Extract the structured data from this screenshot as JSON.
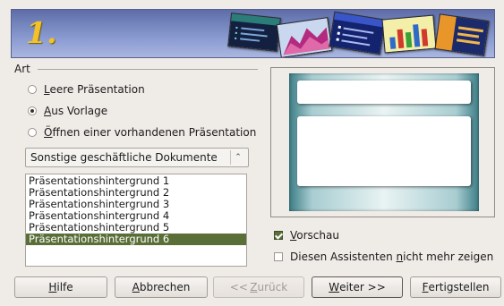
{
  "banner": {
    "step_number": "1."
  },
  "art": {
    "label": "Art",
    "radios": [
      {
        "pre": "",
        "accel": "L",
        "post": "eere Präsentation",
        "selected": false
      },
      {
        "pre": "",
        "accel": "A",
        "post": "us Vorlage",
        "selected": true
      },
      {
        "pre": "",
        "accel": "Ö",
        "post": "ffnen einer vorhandenen Präsentation",
        "selected": false
      }
    ]
  },
  "category_select": {
    "value": "Sonstige geschäftliche Dokumente"
  },
  "template_list": {
    "items": [
      "Präsentationshintergrund 1",
      "Präsentationshintergrund 2",
      "Präsentationshintergrund 3",
      "Präsentationshintergrund 4",
      "Präsentationshintergrund 5",
      "Präsentationshintergrund 6"
    ],
    "selected_index": 5
  },
  "preview_check": {
    "pre": "",
    "accel": "V",
    "post": "orschau",
    "checked": true
  },
  "no_wizard_check": {
    "pre": "Diesen Assistenten ",
    "accel": "n",
    "post": "icht mehr zeigen",
    "checked": false
  },
  "buttons": {
    "help": {
      "pre": "",
      "accel": "H",
      "post": "ilfe"
    },
    "cancel": {
      "pre": "",
      "accel": "A",
      "post": "bbrechen"
    },
    "back": {
      "pre": "<< ",
      "accel": "Z",
      "post": "urück"
    },
    "next": {
      "pre": "",
      "accel": "W",
      "post": "eiter >>"
    },
    "finish": {
      "pre": "",
      "accel": "F",
      "post": "ertigstellen"
    }
  },
  "colors": {
    "accent_green": "#5a6e38",
    "banner_blue": "#7a8bc8",
    "step_number_yellow": "#f3c12a"
  },
  "icons": {
    "banner_thumbnails": [
      "dark-slide-thumbnail",
      "mountain-chart-thumbnail",
      "bullet-list-thumbnail",
      "bar-chart-thumbnail",
      "striped-slide-thumbnail"
    ]
  }
}
